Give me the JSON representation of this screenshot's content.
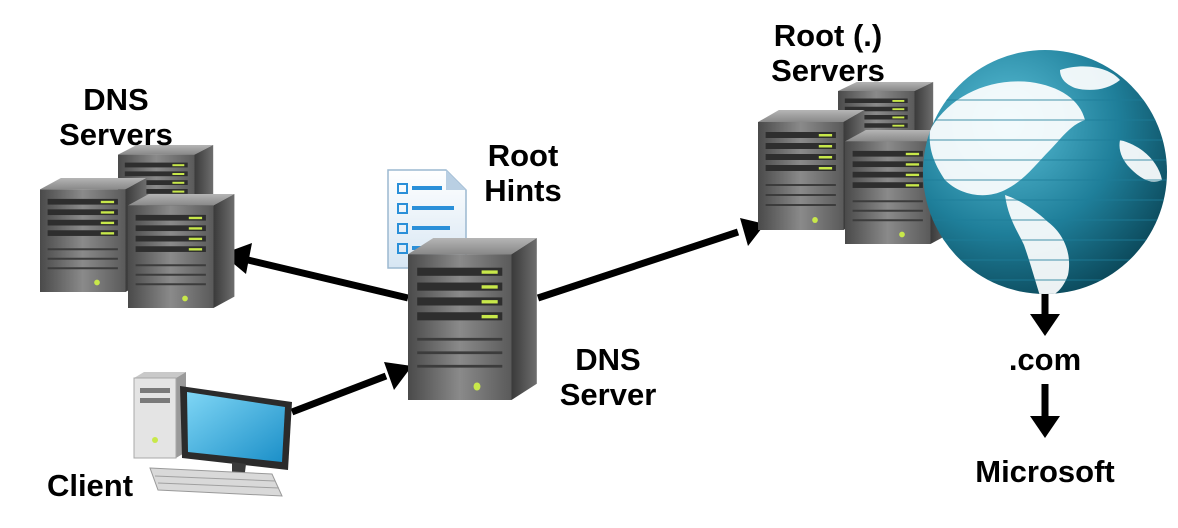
{
  "labels": {
    "dns_servers": [
      "DNS",
      "Servers"
    ],
    "root_hints": [
      "Root",
      "Hints"
    ],
    "root_servers": [
      "Root (.)",
      "Servers"
    ],
    "dns_server": [
      "DNS",
      "Server"
    ],
    "client": "Client",
    "tld": ".com",
    "domain": "Microsoft"
  },
  "icons": {
    "servers": "server-tower-icon",
    "document": "root-hints-document-icon",
    "client": "desktop-computer-icon",
    "globe": "globe-icon"
  },
  "colors": {
    "server_body": "#6f6f6f",
    "server_led": "#c8e84a",
    "globe_ocean": "#1f7f9a",
    "globe_land": "#ffffff",
    "monitor_screen": "#2ab0e6",
    "document_accent": "#2a8fd8",
    "arrow": "#000000"
  }
}
